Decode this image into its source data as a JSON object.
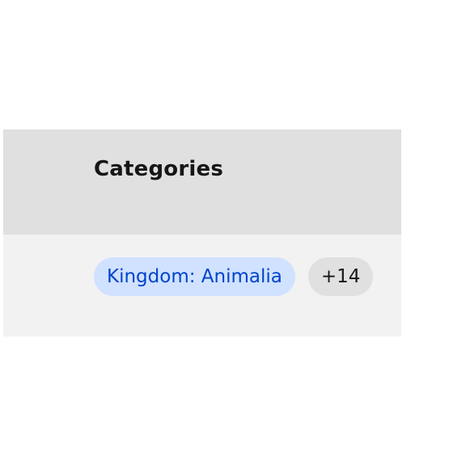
{
  "table": {
    "header": {
      "column_label": "Categories"
    },
    "rows": [
      {
        "tags": [
          {
            "label": "Kingdom: Animalia",
            "color": "#0043ce",
            "background": "#d0e2ff"
          }
        ],
        "overflow_tag": {
          "label": "+14",
          "color": "#161616",
          "background": "#e0e0e0"
        }
      }
    ]
  }
}
